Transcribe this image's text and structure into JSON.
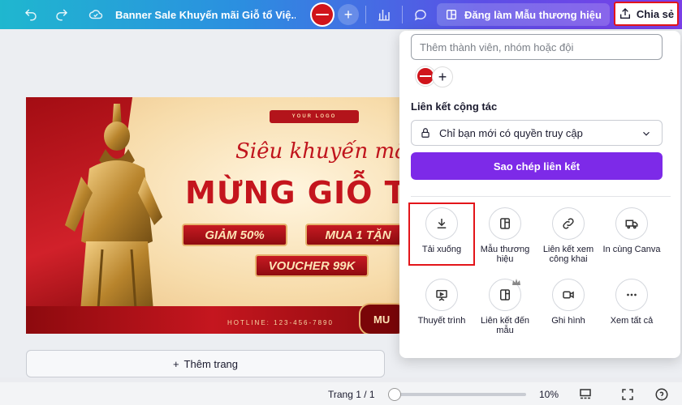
{
  "topbar": {
    "doc_title": "Banner Sale Khuyến mãi Giỗ tổ Việ...",
    "brand_template_label": "Đăng làm Mẫu thương hiệu",
    "share_label": "Chia sẻ"
  },
  "banner": {
    "logo_text": "YOUR LOGO",
    "script_text": "Siêu khuyến mãi",
    "headline": "MỪNG GIỖ T",
    "pill_1": "GIẢM 50%",
    "pill_2": "MUA 1 TẶN",
    "pill_3": "VOUCHER 99K",
    "hotline": "HOTLINE: 123-456-7890",
    "cta": "MU"
  },
  "canvas": {
    "add_page_label": "Thêm trang"
  },
  "bottombar": {
    "page_indicator": "Trang 1 / 1",
    "zoom": "10%",
    "zoom_fraction": 0.1
  },
  "share_panel": {
    "search_placeholder": "Thêm thành viên, nhóm hoặc đội",
    "collab_label": "Liên kết cộng tác",
    "access_value": "Chỉ bạn mới có quyền truy cập",
    "copy_link_label": "Sao chép liên kết",
    "options": [
      {
        "label": "Tải xuống",
        "icon": "download-icon"
      },
      {
        "label": "Mẫu thương hiệu",
        "icon": "template-icon"
      },
      {
        "label": "Liên kết xem công khai",
        "icon": "link-icon"
      },
      {
        "label": "In cùng Canva",
        "icon": "truck-icon"
      },
      {
        "label": "Thuyết trình",
        "icon": "present-icon"
      },
      {
        "label": "Liên kết đến mẫu",
        "icon": "template-link-icon"
      },
      {
        "label": "Ghi hình",
        "icon": "camera-icon"
      },
      {
        "label": "Xem tất cả",
        "icon": "more-icon"
      }
    ]
  },
  "colors": {
    "accent_purple": "#7d2ae8",
    "highlight_red": "#e3151a",
    "banner_red": "#c4151d"
  }
}
